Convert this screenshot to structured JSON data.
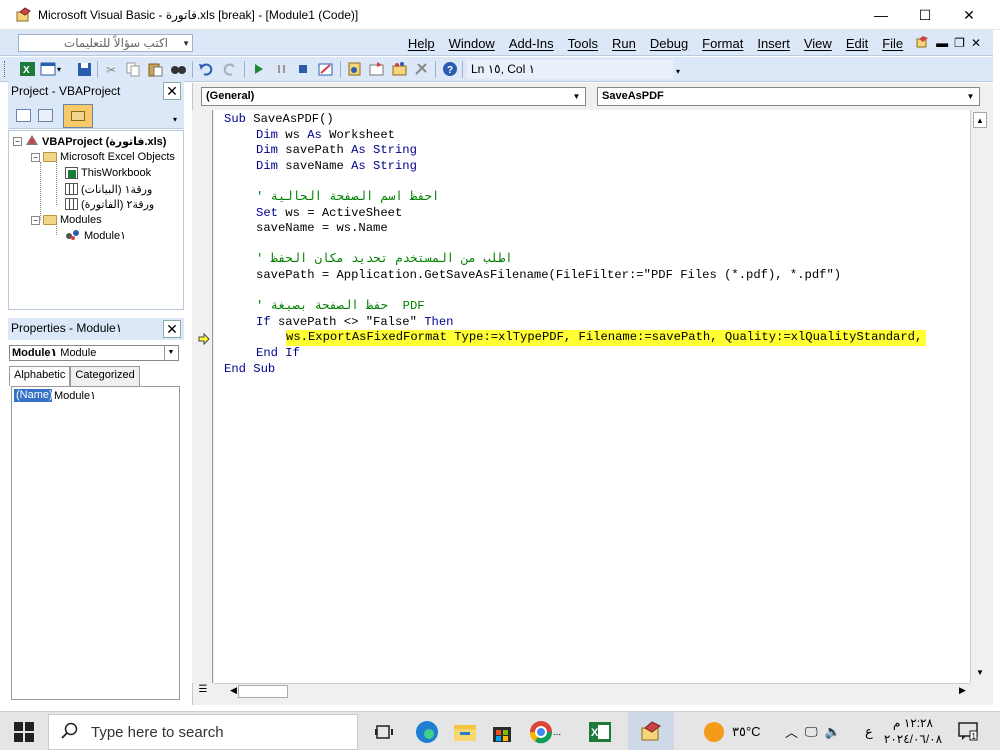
{
  "window": {
    "title": "Microsoft Visual Basic - فاتورة.xls [break] - [Module1 (Code)]",
    "minimize": "—",
    "maximize": "☐",
    "close": "✕"
  },
  "menubar": {
    "ask_placeholder": "اكتب سؤالاً للتعليمات",
    "items": [
      "Help",
      "Window",
      "Add-Ins",
      "Tools",
      "Run",
      "Debug",
      "Format",
      "Insert",
      "View",
      "Edit",
      "File"
    ]
  },
  "toolbar": {
    "position": "Ln ١٥, Col ١"
  },
  "project": {
    "title": "Project - VBAProject",
    "root": "VBAProject (فاتورة.xls)",
    "excel_objects": "Microsoft Excel Objects",
    "this_workbook": "ThisWorkbook",
    "sheet1": "ورقة١ (البيانات)",
    "sheet2": "ورقة٢ (الفاتورة)",
    "modules": "Modules",
    "module1": "Module١"
  },
  "properties": {
    "title": "Properties - Module١",
    "object_name": "Module١",
    "object_type": "Module",
    "tab_alphabetic": "Alphabetic",
    "tab_categorized": "Categorized",
    "prop_name": "(Name)",
    "prop_value": "Module١"
  },
  "code": {
    "object_combo": "(General)",
    "proc_combo": "SaveAsPDF",
    "lines": {
      "l1_kw": "Sub",
      "l1_rest": " SaveAsPDF()",
      "l2_kw": "Dim",
      "l2_rest": " ws ",
      "l2_kw2": "As",
      "l2_rest2": " Worksheet",
      "l3_kw": "Dim",
      "l3_rest": " savePath ",
      "l3_kw2": "As",
      "l3_kw3": " String",
      "l4_kw": "Dim",
      "l4_rest": " saveName ",
      "l4_kw2": "As",
      "l4_kw3": " String",
      "l5_comment": "احفظ اسم الصفحة الحالية '",
      "l6_kw": "Set",
      "l6_rest": " ws = ActiveSheet",
      "l7": "saveName = ws.Name",
      "l8_comment": "اطلب من المستخدم تحديد مكان الحفظ '",
      "l9": "savePath = Application.GetSaveAsFilename(FileFilter:=\"PDF Files (*.pdf), *.pdf\")",
      "l10_comment": "' حفظ الصفحة بصيغة  PDF",
      "l11_kw": "If",
      "l11_rest": " savePath <> \"False\" ",
      "l11_kw2": "Then",
      "l12": "ws.ExportAsFixedFormat Type:=xlTypePDF, Filename:=savePath, Quality:=xlQualityStandard,",
      "l13_kw": "End If",
      "l14_kw": "End Sub"
    }
  },
  "taskbar": {
    "search_placeholder": "Type here to search",
    "weather": "٣٥°C",
    "lang": "ع",
    "time": "١٢:٢٨ م",
    "date": "٢٠٢٤/٠٦/٠٨"
  },
  "colors": {
    "chrome": "#dce8f7",
    "keyword": "#00008b",
    "comment": "#008000",
    "highlight": "#ffff33"
  }
}
